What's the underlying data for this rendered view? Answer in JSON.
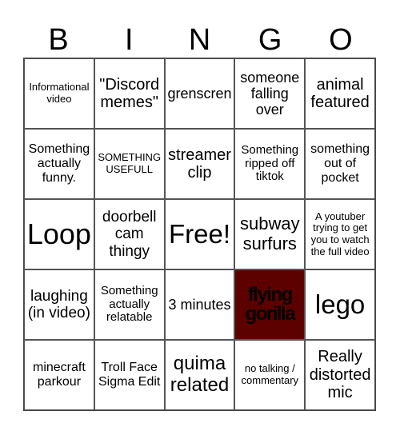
{
  "header": {
    "letters": [
      "B",
      "I",
      "N",
      "G",
      "O"
    ]
  },
  "colors": {
    "marked_cell": "#5c0000"
  },
  "rows": [
    [
      "Informational video",
      "\"Discord memes\"",
      "grenscren",
      "someone falling over",
      "animal featured"
    ],
    [
      "Something actually funny.",
      "SOMETHING USEFULL",
      "streamer clip",
      "Something ripped off tiktok",
      "something out of pocket"
    ],
    [
      "Loop",
      "doorbell cam thingy",
      "Free!",
      "subway surfurs",
      "A youtuber trying to get you to watch the full video"
    ],
    [
      "laughing (in video)",
      "Something actually relatable",
      "3 minutes",
      "flying gorilla",
      "lego"
    ],
    [
      "minecraft parkour",
      "Troll Face Sigma Edit",
      "quima related",
      "no talking / commentary",
      "Really distorted mic"
    ]
  ]
}
